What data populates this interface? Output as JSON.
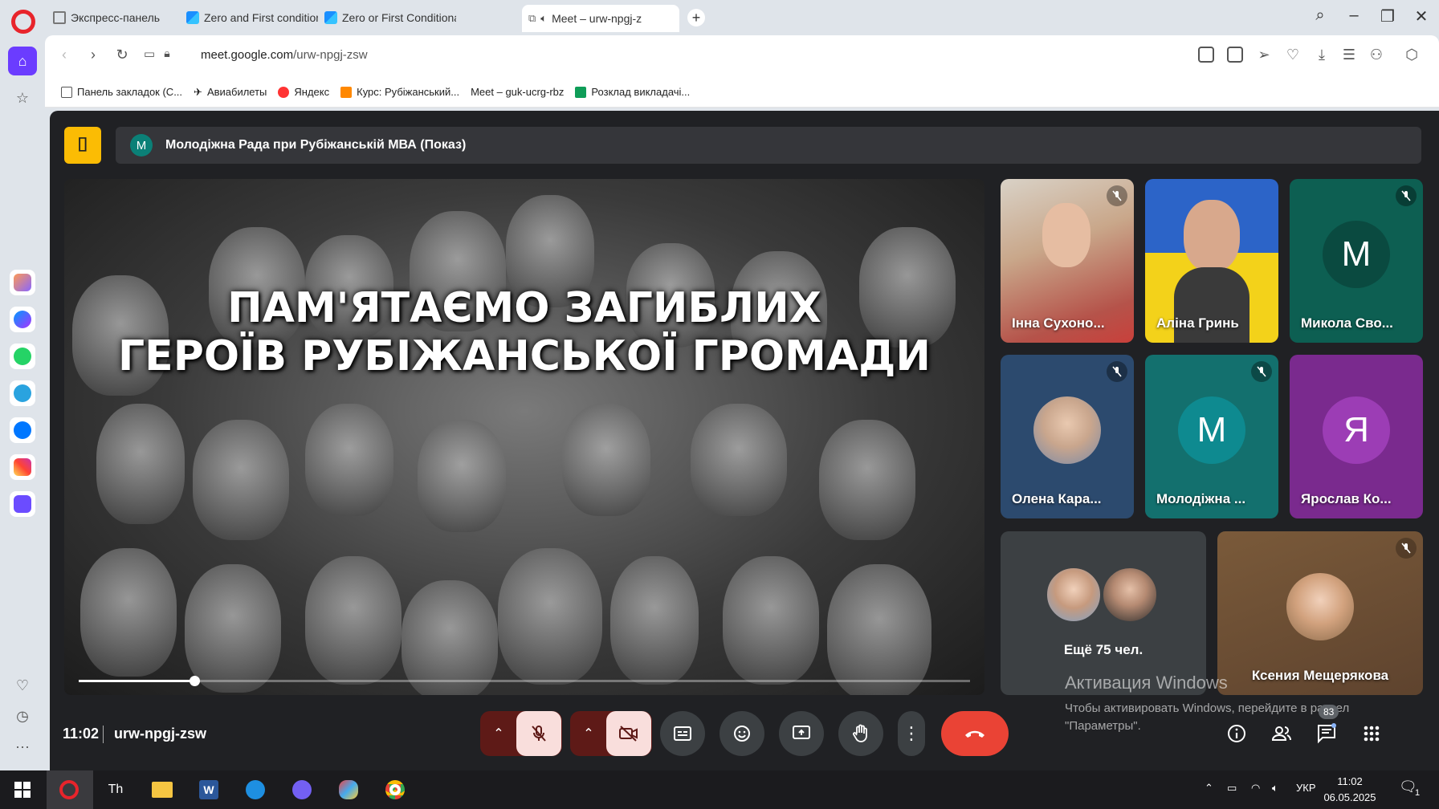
{
  "browser": {
    "tabs": [
      {
        "label": "Экспресс-панель",
        "icon": "grid-icon"
      },
      {
        "label": "Zero and First conditional",
        "icon": "liveworksheets-icon"
      },
      {
        "label": "Zero or First Conditional -",
        "icon": "liveworksheets-icon"
      },
      {
        "label": "Meet – urw-npgj-z",
        "icon": "meet-icon"
      }
    ],
    "address": {
      "host": "meet.google.com",
      "path": "/urw-npgj-zsw"
    },
    "bookmarks": [
      {
        "label": "Панель закладок (С...",
        "icon": "folder-icon"
      },
      {
        "label": "Авиабилеты",
        "icon": "plane-icon"
      },
      {
        "label": "Яндекс",
        "icon": "yandex-icon"
      },
      {
        "label": "Курс: Рубіжанський...",
        "icon": "course-icon"
      },
      {
        "label": "Meet – guk-ucrg-rbz",
        "icon": "meet-icon"
      },
      {
        "label": "Розклад викладачі...",
        "icon": "sheets-icon"
      }
    ]
  },
  "meet": {
    "presenter_initial": "М",
    "presentation_title": "Молодіжна Рада при Рубіжанській МВА (Показ)",
    "slide": {
      "line1": "ПАМ'ЯТАЄМО ЗАГИБЛИХ",
      "line2": "ГЕРОЇВ РУБІЖАНСЬКОЇ ГРОМАДИ",
      "progress": 0.13
    },
    "participants": [
      {
        "name": "Інна Сухоно...",
        "muted": true
      },
      {
        "name": "Аліна Гринь",
        "muted": false
      },
      {
        "name": "Микола Сво...",
        "initial": "М",
        "muted": true
      },
      {
        "name": "Олена Кара...",
        "muted": true
      },
      {
        "name": "Молодіжна ...",
        "initial": "М",
        "muted": true
      },
      {
        "name": "Ярослав Ко...",
        "initial": "Я",
        "muted": false
      },
      {
        "name": "Ксения Мещерякова",
        "muted": true
      }
    ],
    "more_participants": "Ещё 75 чел.",
    "time": "11:02",
    "meeting_code": "urw-npgj-zsw",
    "participant_count": "83",
    "watermark": {
      "title": "Активация Windows",
      "text": "Чтобы активировать Windows, перейдите в раздел \"Параметры\"."
    }
  },
  "taskbar": {
    "language": "УКР",
    "time": "11:02",
    "date": "06.05.2025",
    "notifications": "1"
  }
}
